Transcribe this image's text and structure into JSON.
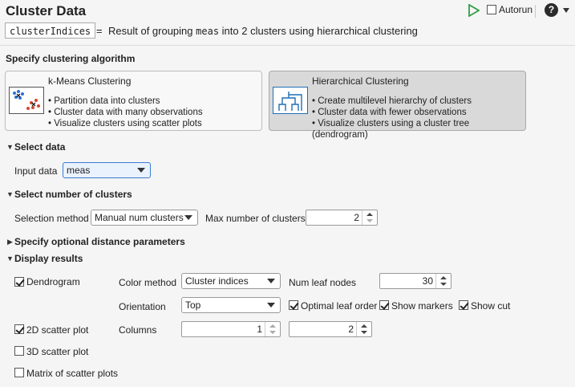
{
  "header": {
    "title": "Cluster Data",
    "autorun_label": "Autorun",
    "help_label": "?",
    "output_variable": "clusterIndices",
    "equals": "=",
    "summary_prefix": "Result of grouping",
    "summary_code": "meas",
    "summary_suffix": "into 2 clusters using hierarchical clustering"
  },
  "algorithm": {
    "heading": "Specify clustering algorithm",
    "options": [
      {
        "title": "k-Means Clustering",
        "bullets": [
          "• Partition data into clusters",
          "• Cluster data with many observations",
          "• Visualize clusters using scatter plots"
        ],
        "selected": false
      },
      {
        "title": "Hierarchical Clustering",
        "bullets": [
          "• Create multilevel hierarchy of clusters",
          "• Cluster data with fewer observations",
          "• Visualize clusters using a cluster tree (dendrogram)"
        ],
        "selected": true
      }
    ]
  },
  "select_data": {
    "heading": "Select data",
    "input_label": "Input data",
    "input_value": "meas"
  },
  "num_clusters": {
    "heading": "Select number of clusters",
    "method_label": "Selection method",
    "method_value": "Manual num clusters",
    "max_label": "Max number of clusters",
    "max_value": "2"
  },
  "distance": {
    "heading": "Specify optional distance parameters"
  },
  "display": {
    "heading": "Display results",
    "dendrogram_label": "Dendrogram",
    "color_method_label": "Color method",
    "color_method_value": "Cluster indices",
    "num_leaf_label": "Num leaf nodes",
    "num_leaf_value": "30",
    "orientation_label": "Orientation",
    "orientation_value": "Top",
    "optimal_leaf_label": "Optimal leaf order",
    "show_markers_label": "Show markers",
    "show_cut_label": "Show cut",
    "scatter2d_label": "2D scatter plot",
    "columns_label": "Columns",
    "column1_value": "1",
    "column2_value": "2",
    "scatter3d_label": "3D scatter plot",
    "matrix_label": "Matrix of scatter plots"
  },
  "colors": {
    "run_green": "#2ea043",
    "selected_card": "#d9d9d9",
    "icon_blue": "#1f6fb5",
    "dot_red": "#d1462f",
    "dot_blue": "#2f6fd1"
  }
}
